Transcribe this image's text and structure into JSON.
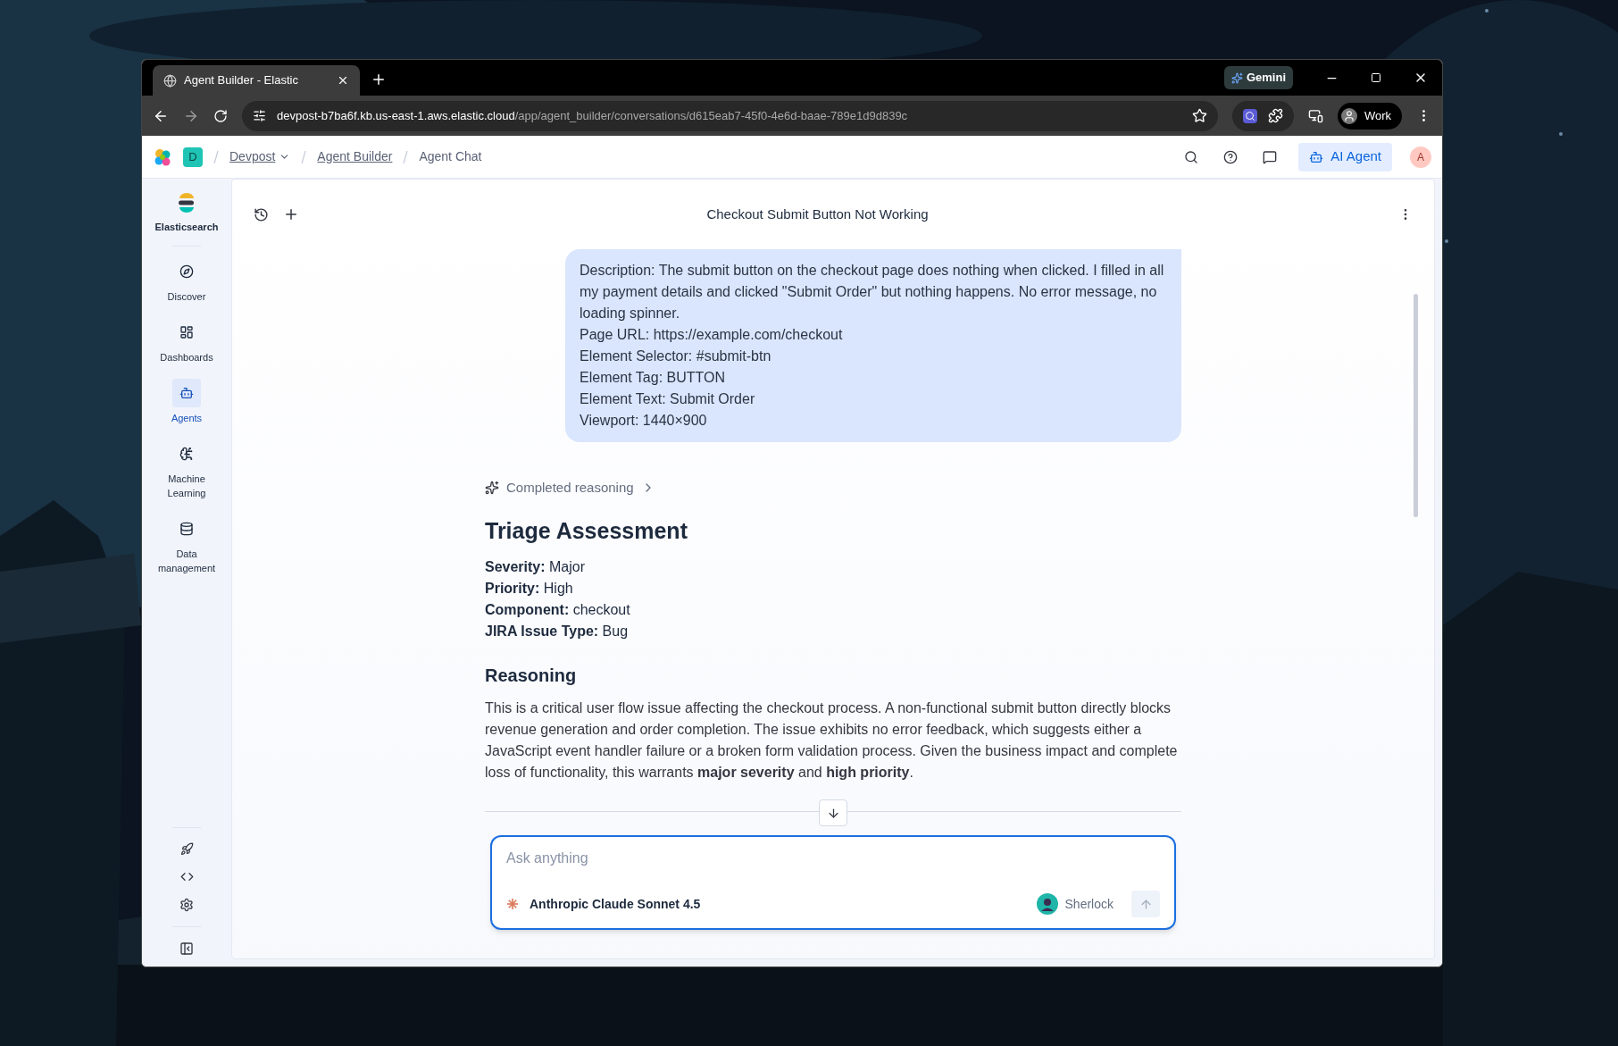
{
  "browser": {
    "tab": {
      "title": "Agent Builder - Elastic",
      "selected": true
    },
    "gemini": "Gemini",
    "url": {
      "host": "devpost-b7ba6f.kb.us-east-1.aws.elastic.cloud",
      "path": "/app/agent_builder/conversations/d615eab7-45f0-4e6d-baae-789e1d9d839c"
    },
    "profile": "Work"
  },
  "header": {
    "space_badge": "D",
    "breadcrumbs": [
      {
        "label": "Devpost",
        "kind": "dropdown"
      },
      {
        "label": "Agent Builder",
        "kind": "link"
      },
      {
        "label": "Agent Chat",
        "kind": "current"
      }
    ],
    "ai_agent_button": "AI Agent",
    "avatar": "A"
  },
  "sidebar": {
    "brand": "Elasticsearch",
    "items": [
      {
        "label": "Discover",
        "selected": false
      },
      {
        "label": "Dashboards",
        "selected": false
      },
      {
        "label": "Agents",
        "selected": true
      },
      {
        "label": "Machine Learning",
        "selected": false
      },
      {
        "label": "Data management",
        "selected": false
      }
    ]
  },
  "conversation": {
    "title": "Checkout Submit Button Not Working",
    "user_message": [
      "Description: The submit button on the checkout page does nothing when clicked. I filled in all my payment details and clicked \"Submit Order\" but nothing happens. No error message, no loading spinner.",
      "Page URL: https://example.com/checkout",
      "Element Selector: #submit-btn",
      "Element Tag: BUTTON",
      "Element Text: Submit Order",
      "Viewport: 1440×900"
    ],
    "reasoning": "Completed reasoning",
    "heading": "Triage Assessment",
    "fields": [
      "**Severity:** Major",
      "**Priority:** High",
      "**Component:** checkout",
      "**JIRA Issue Type:** Bug"
    ],
    "subheading": "Reasoning",
    "paragraph": "This is a critical user flow issue affecting the checkout process. A non-functional submit button directly blocks revenue generation and order completion. The issue exhibits no error feedback, which suggests either a JavaScript event handler failure or a broken form validation process. Given the business impact and complete loss of functionality, this warrants **major severity** and **high priority**."
  },
  "composer": {
    "placeholder": "Ask anything",
    "model": "Anthropic Claude Sonnet 4.5",
    "agent": "Sherlock"
  }
}
